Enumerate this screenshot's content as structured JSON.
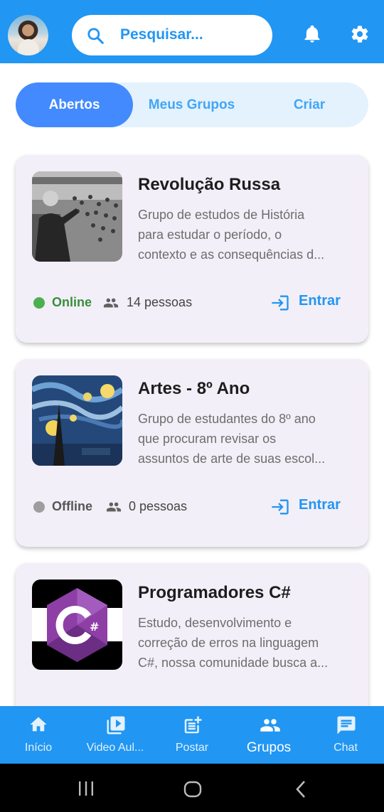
{
  "header": {
    "search_placeholder": "Pesquisar...",
    "icons": [
      "avatar",
      "search-icon",
      "bell-icon",
      "gear-icon"
    ]
  },
  "tabs": [
    {
      "label": "Abertos",
      "active": true
    },
    {
      "label": "Meus Grupos",
      "active": false
    },
    {
      "label": "Criar",
      "active": false
    }
  ],
  "groups": [
    {
      "title": "Revolução Russa",
      "description": [
        "Grupo de estudos de História",
        "para estudar o período, o",
        "contexto e as consequências d..."
      ],
      "status": "Online",
      "status_color": "#4CAF50",
      "members": "14 pessoas",
      "action": "Entrar"
    },
    {
      "title": "Artes - 8º Ano",
      "description": [
        "Grupo de estudantes do 8º ano",
        "que procuram revisar os",
        "assuntos de arte de suas escol..."
      ],
      "status": "Offline",
      "status_color": "#9E9E9E",
      "members": "0 pessoas",
      "action": "Entrar"
    },
    {
      "title": "Programadores C#",
      "description": [
        "Estudo, desenvolvimento e",
        "correção de erros na linguagem",
        "C#, nossa comunidade busca a..."
      ],
      "status": "",
      "members": "",
      "action": ""
    }
  ],
  "bottom_nav": [
    {
      "label": "Início",
      "icon": "home-icon",
      "active": false
    },
    {
      "label": "Video Aul...",
      "icon": "video-icon",
      "active": false
    },
    {
      "label": "Postar",
      "icon": "post-add-icon",
      "active": false
    },
    {
      "label": "Grupos",
      "icon": "groups-icon",
      "active": true
    },
    {
      "label": "Chat",
      "icon": "chat-icon",
      "active": false
    }
  ],
  "colors": {
    "primary": "#2196F3",
    "tab_active": "#448AFF",
    "card_bg": "#F3EFF8",
    "online": "#4CAF50",
    "offline": "#9E9E9E"
  }
}
